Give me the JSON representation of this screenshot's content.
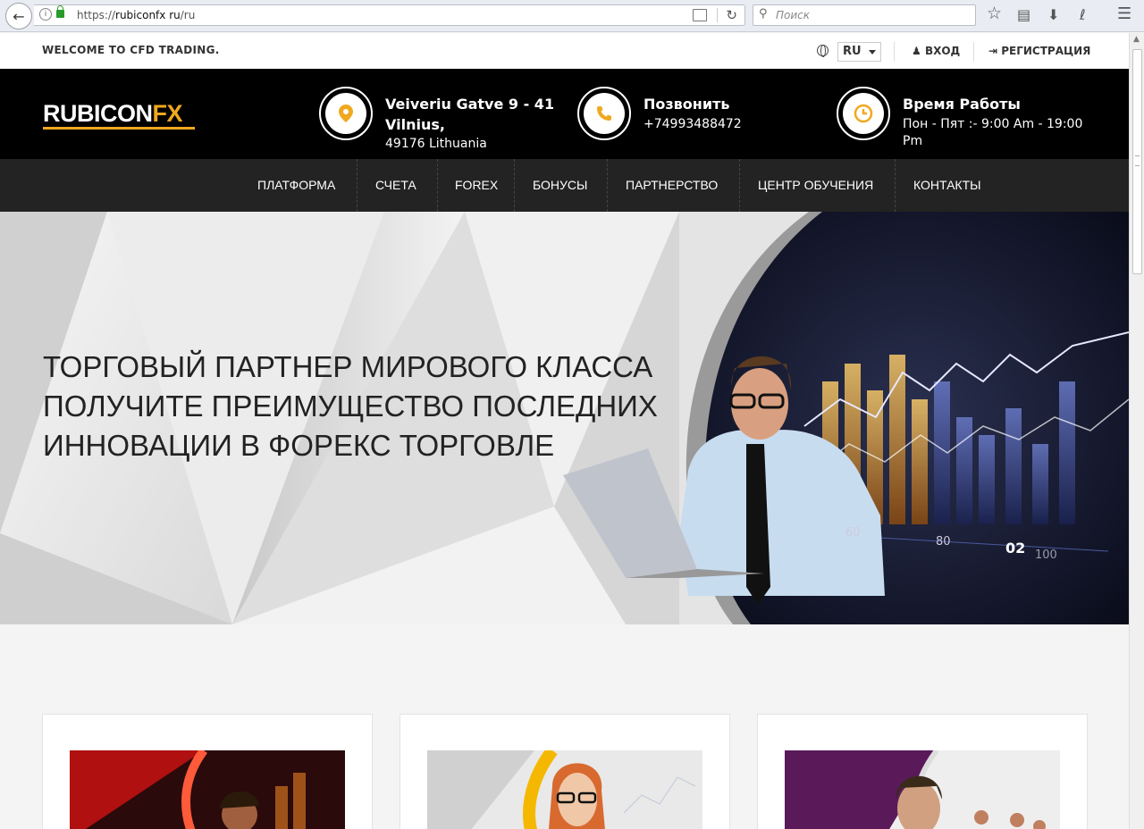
{
  "browser": {
    "url_prefix": "https://",
    "url_domain": "rubiconfx ru",
    "url_path": "/ru",
    "search_placeholder": "Поиск"
  },
  "topbar": {
    "welcome": "WELCOME TO CFD TRADING.",
    "lang": "RU",
    "login": "ВХОД",
    "register": "РЕГИСТРАЦИЯ"
  },
  "logo": {
    "part1": "RUBICON",
    "part2": "FX"
  },
  "header": {
    "address": {
      "title": "Veiveriu Gatve 9 - 41",
      "title2": "Vilnius,",
      "sub": "49176 Lithuania"
    },
    "phone": {
      "title": "Позвонить",
      "sub": "+74993488472"
    },
    "hours": {
      "title": "Время Работы",
      "sub": "Пон - Пят :- 9:00 Am - 19:00",
      "sub2": "Pm"
    }
  },
  "nav": [
    "ПЛАТФОРМА",
    "СЧЕТА",
    "FOREX",
    "БОНУСЫ",
    "ПАРТНЕРСТВО",
    "ЦЕНТР ОБУЧЕНИЯ",
    "КОНТАКТЫ"
  ],
  "hero": {
    "line1": "ТОРГОВЫЙ ПАРТНЕР МИРОВОГО КЛАССА",
    "line2": "ПОЛУЧИТЕ ПРЕИМУЩЕСТВО ПОСЛЕДНИХ",
    "line3": "ИННОВАЦИИ В ФОРЕКС ТОРГОВЛЕ",
    "slide": "02",
    "chart_labels": [
      "60",
      "80",
      "100"
    ]
  },
  "colors": {
    "accent": "#f0a81e",
    "header_bg": "#000000",
    "nav_bg": "#232323"
  }
}
